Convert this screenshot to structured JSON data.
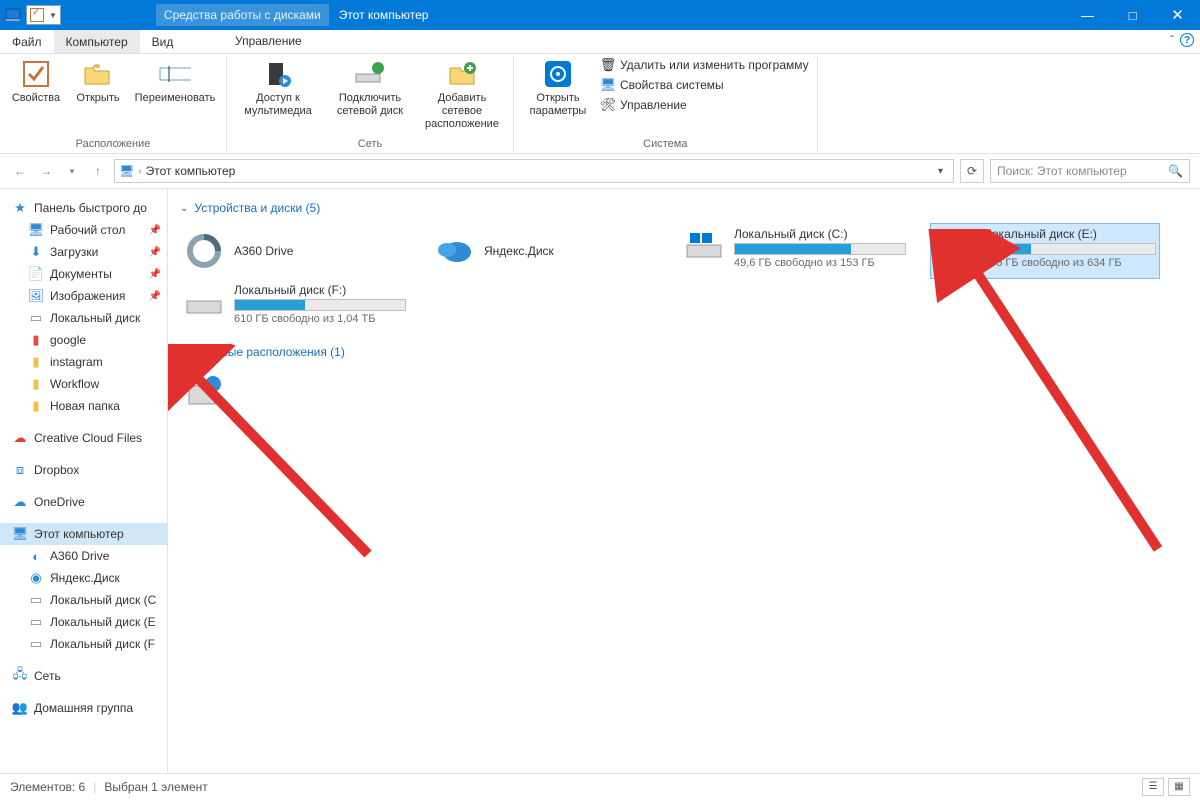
{
  "titlebar": {
    "contextual_label": "Средства работы с дисками",
    "window_title": "Этот компьютер"
  },
  "tabs": {
    "file": "Файл",
    "computer": "Компьютер",
    "view": "Вид",
    "manage": "Управление"
  },
  "ribbon": {
    "group_location": "Расположение",
    "group_network": "Сеть",
    "group_system": "Система",
    "btn_properties": "Свойства",
    "btn_open": "Открыть",
    "btn_rename": "Переименовать",
    "btn_media_access": "Доступ к мультимедиа",
    "btn_map_drive": "Подключить сетевой диск",
    "btn_add_netloc": "Добавить сетевое расположение",
    "btn_open_options": "Открыть параметры",
    "small_uninstall": "Удалить или изменить программу",
    "small_sysprops": "Свойства системы",
    "small_manage": "Управление"
  },
  "address": {
    "breadcrumb": "Этот компьютер",
    "search_placeholder": "Поиск: Этот компьютер"
  },
  "nav": {
    "quick_access": "Панель быстрого до",
    "desktop": "Рабочий стол",
    "downloads": "Загрузки",
    "documents": "Документы",
    "pictures": "Изображения",
    "local_disk_short": "Локальный диск",
    "google": "google",
    "instagram": "instagram",
    "workflow": "Workflow",
    "newfolder": "Новая папка",
    "creative_cloud": "Creative Cloud Files",
    "dropbox": "Dropbox",
    "onedrive": "OneDrive",
    "this_pc": "Этот компьютер",
    "a360": "A360 Drive",
    "yandex": "Яндекс.Диск",
    "local_c": "Локальный диск (С",
    "local_e": "Локальный диск (Е",
    "local_f": "Локальный диск (F",
    "network": "Сеть",
    "homegroup": "Домашняя группа"
  },
  "content": {
    "devices_header": "Устройства и диски (5)",
    "netloc_header": "Сетевые расположения (1)",
    "a360": "A360 Drive",
    "yandex": "Яндекс.Диск",
    "disk_c_name": "Локальный диск (C:)",
    "disk_c_free": "49,6 ГБ свободно из 153 ГБ",
    "disk_c_fill_pct": 68,
    "disk_e_name": "Локальный диск (E:)",
    "disk_e_free": "465 ГБ свободно из 634 ГБ",
    "disk_e_fill_pct": 27,
    "disk_f_name": "Локальный диск (F:)",
    "disk_f_free": "610 ГБ свободно из 1,04 ТБ",
    "disk_f_fill_pct": 41
  },
  "status": {
    "items": "Элементов: 6",
    "selected": "Выбран 1 элемент"
  }
}
